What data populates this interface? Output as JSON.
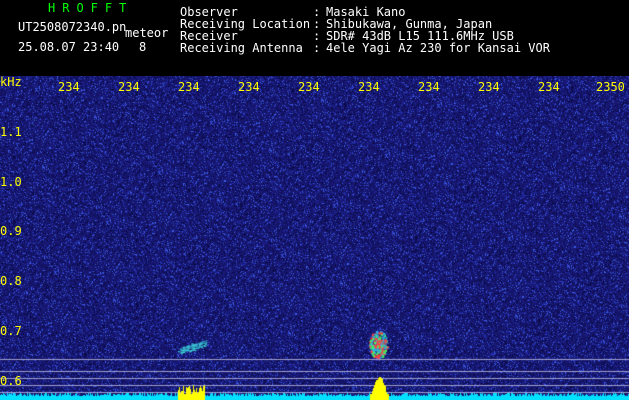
{
  "header": {
    "brand": "HROFFT",
    "filename": "UT2508072340.pn",
    "mode": "meteor",
    "datetime": "25.08.07 23:40",
    "count": "8",
    "fields": [
      {
        "label": "Observer",
        "value": "Masaki Kano"
      },
      {
        "label": "Receiving Location",
        "value": "Shibukawa, Gunma, Japan"
      },
      {
        "label": "Receiver",
        "value": "SDR# 43dB L15 111.6MHz USB"
      },
      {
        "label": "Receiving Antenna",
        "value": "4ele Yagi Az 230 for Kansai VOR"
      }
    ],
    "separator": ":"
  },
  "axes": {
    "y_unit": "kHz",
    "y_ticks": [
      "1.1",
      "1.0",
      "0.9",
      "0.8",
      "0.7",
      "0.6"
    ],
    "x_ticks": [
      "234",
      "234",
      "234",
      "234",
      "234",
      "234",
      "234",
      "234",
      "234",
      "2350"
    ]
  },
  "colors": {
    "background_noise": "#1a1a78",
    "text_white": "#ffffff",
    "text_yellow": "#ffff00",
    "brand_green": "#00ff00",
    "baseline_cyan": "#00e0ff",
    "echo_yellow": "#ffff00"
  }
}
